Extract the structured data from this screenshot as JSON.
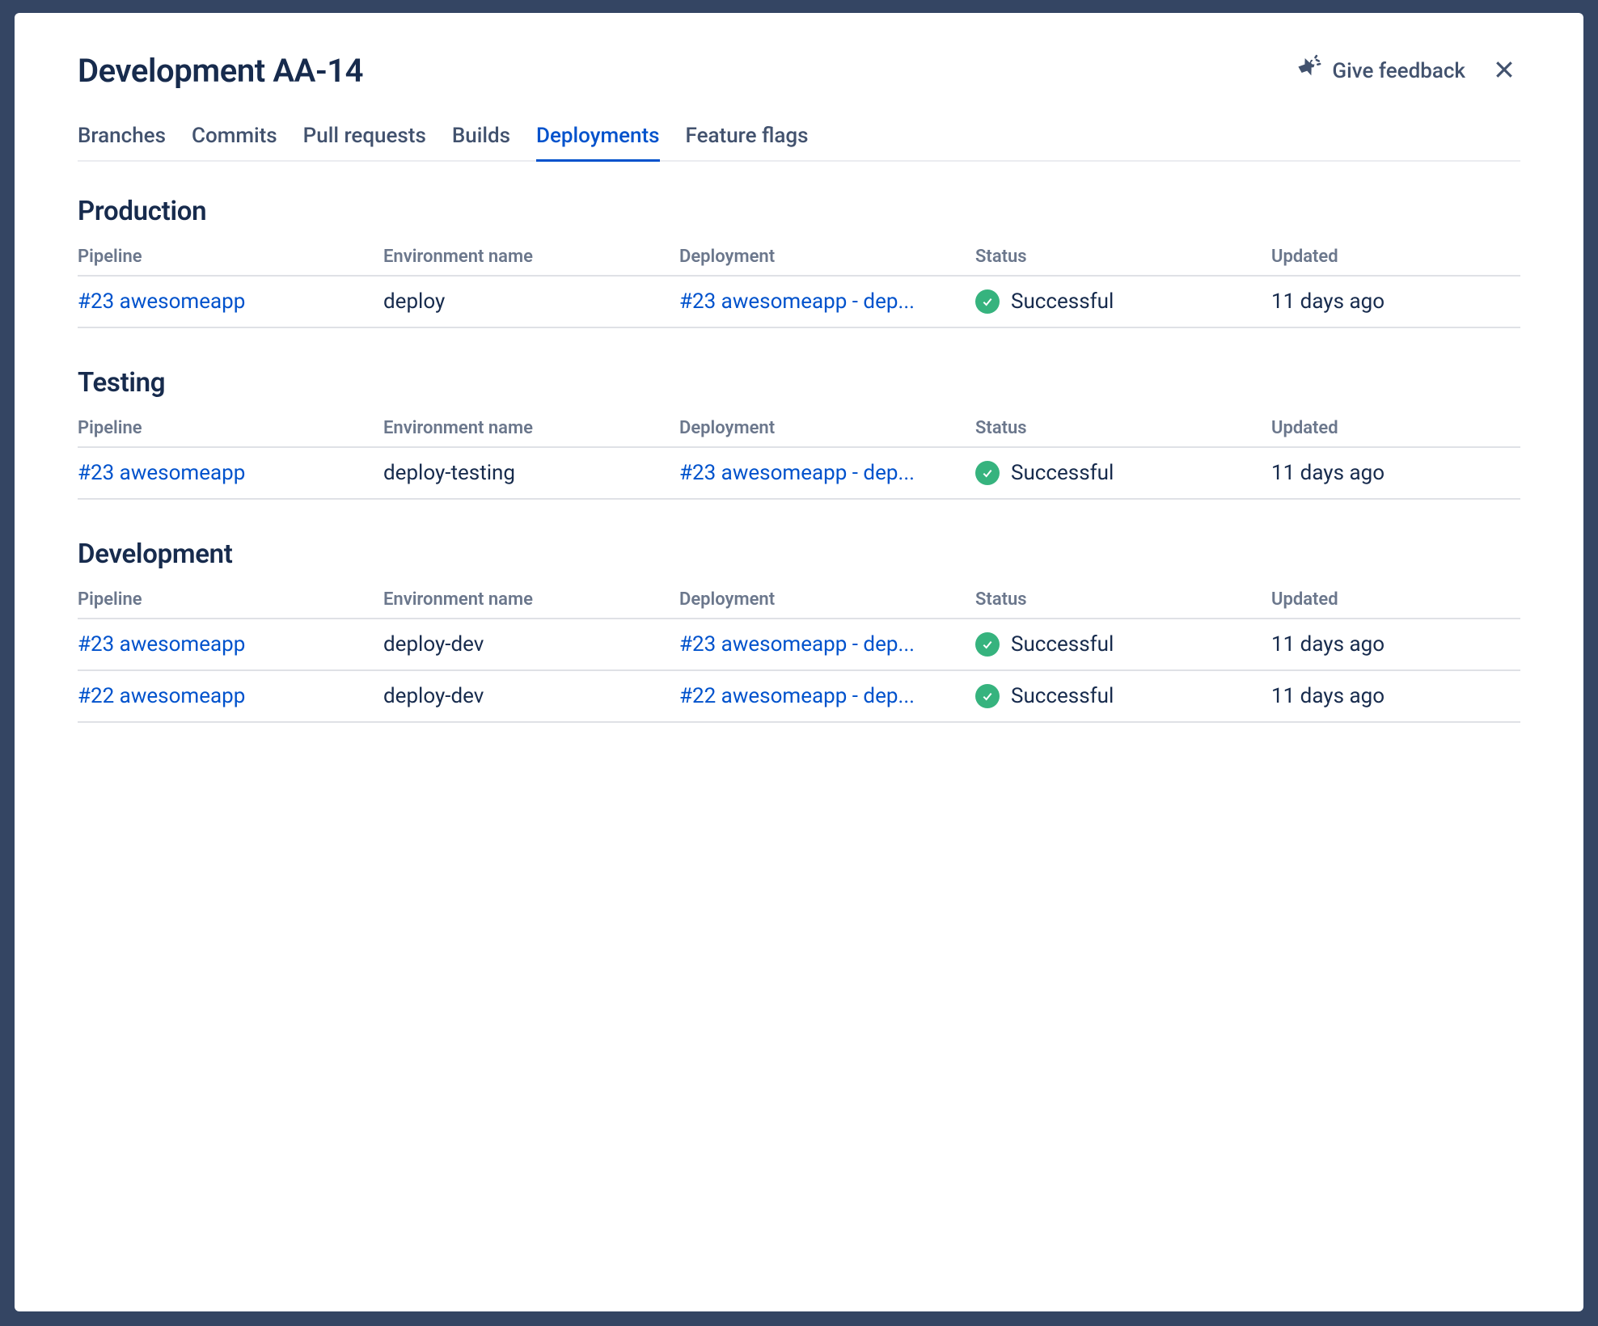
{
  "header": {
    "title": "Development AA-14",
    "feedback_label": "Give feedback"
  },
  "tabs": [
    {
      "label": "Branches",
      "active": false
    },
    {
      "label": "Commits",
      "active": false
    },
    {
      "label": "Pull requests",
      "active": false
    },
    {
      "label": "Builds",
      "active": false
    },
    {
      "label": "Deployments",
      "active": true
    },
    {
      "label": "Feature flags",
      "active": false
    }
  ],
  "columns": {
    "pipeline": "Pipeline",
    "env": "Environment name",
    "deployment": "Deployment",
    "status": "Status",
    "updated": "Updated"
  },
  "sections": [
    {
      "title": "Production",
      "rows": [
        {
          "pipeline": "#23 awesomeapp",
          "env": "deploy",
          "deployment": "#23 awesomeapp - dep...",
          "status": "Successful",
          "updated": "11 days ago"
        }
      ]
    },
    {
      "title": "Testing",
      "rows": [
        {
          "pipeline": "#23 awesomeapp",
          "env": "deploy-testing",
          "deployment": "#23 awesomeapp - dep...",
          "status": "Successful",
          "updated": "11 days ago"
        }
      ]
    },
    {
      "title": "Development",
      "rows": [
        {
          "pipeline": "#23 awesomeapp",
          "env": "deploy-dev",
          "deployment": "#23 awesomeapp - dep...",
          "status": "Successful",
          "updated": "11 days ago"
        },
        {
          "pipeline": "#22 awesomeapp",
          "env": "deploy-dev",
          "deployment": "#22 awesomeapp - dep...",
          "status": "Successful",
          "updated": "11 days ago"
        }
      ]
    }
  ]
}
